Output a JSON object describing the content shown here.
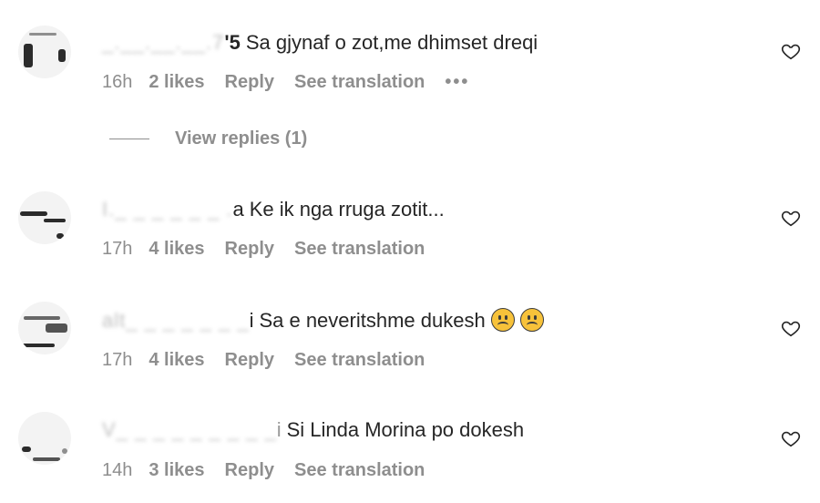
{
  "comments": [
    {
      "user_visible": "_.__.__.__.7",
      "user_tail": "'5",
      "text": "Sa gjynaf o zot,me dhimset dreqi",
      "time": "16h",
      "likes": "2 likes",
      "reply": "Reply",
      "translate": "See translation",
      "more": "•••",
      "view_replies": "View replies (1)"
    },
    {
      "user_visible": "I._ _ _ _ _ _ .",
      "user_tail": "a",
      "text": "Ke ik nga rruga zotit...",
      "time": "17h",
      "likes": "4 likes",
      "reply": "Reply",
      "translate": "See translation"
    },
    {
      "user_visible": "alt_ _ _ _ _ _ _",
      "user_tail": "i",
      "text": "Sa e neveritshme dukesh",
      "time": "17h",
      "likes": "4 likes",
      "reply": "Reply",
      "translate": "See translation"
    },
    {
      "user_visible": "V_ _ _ _ _ _ _ _ _",
      "user_tail": "i",
      "text": "Si Linda Morina po dokesh",
      "time": "14h",
      "likes": "3 likes",
      "reply": "Reply",
      "translate": "See translation"
    }
  ],
  "icons": {
    "like": "heart-outline-icon",
    "emoji": "frowning-face-emoji"
  }
}
